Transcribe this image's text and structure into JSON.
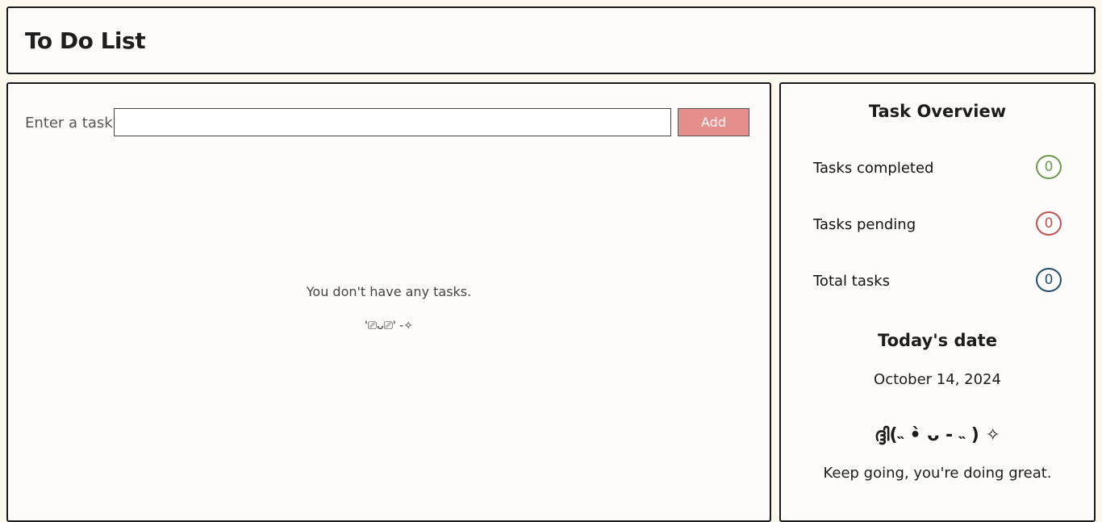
{
  "header": {
    "title": "To Do List"
  },
  "task_entry": {
    "label": "Enter a task",
    "input_value": "",
    "add_label": "Add"
  },
  "empty_state": {
    "message": "You don't have any tasks.",
    "face": "'⎚ᴗ⎚' -✧"
  },
  "overview": {
    "title": "Task Overview",
    "stats": [
      {
        "label": "Tasks completed",
        "count": "0",
        "color": "#6a9a4a"
      },
      {
        "label": "Tasks pending",
        "count": "0",
        "color": "#c0504d"
      },
      {
        "label": "Total tasks",
        "count": "0",
        "color": "#1f4e6b"
      }
    ]
  },
  "date_panel": {
    "title": "Today's date",
    "date": "October 14, 2024",
    "kaomoji": "ദ്ദി(˵ •̀ ᴗ - ˵ ) ✧",
    "message": "Keep going, you're doing great."
  },
  "colors": {
    "add_button": "#e48f8b",
    "border": "#1a1a1a",
    "page_bg": "#fdf8ee"
  }
}
